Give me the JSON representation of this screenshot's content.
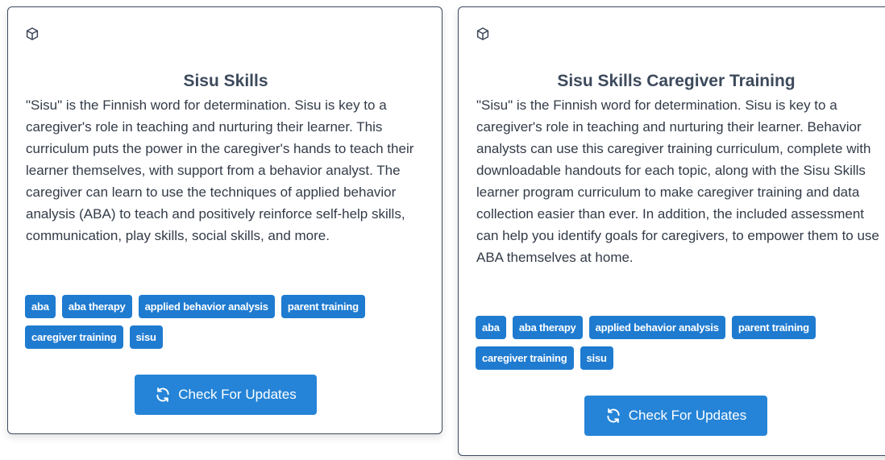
{
  "cards": [
    {
      "icon": "cube-icon",
      "title": "Sisu Skills",
      "description": "\"Sisu\" is the Finnish word for determination. Sisu is key to a caregiver's role in teaching and nurturing their learner. This curriculum puts the power in the caregiver's hands to teach their learner themselves, with support from a behavior analyst. The caregiver can learn to use the techniques of applied behavior analysis (ABA) to teach and positively reinforce self-help skills, communication, play skills, social skills, and more.",
      "tags": [
        "aba",
        "aba therapy",
        "applied behavior analysis",
        "parent training",
        "caregiver training",
        "sisu"
      ],
      "button_label": "Check For Updates",
      "button_icon": "refresh-icon"
    },
    {
      "icon": "cube-icon",
      "title": "Sisu Skills Caregiver Training",
      "description": "\"Sisu\" is the Finnish word for determination. Sisu is key to a caregiver's role in teaching and nurturing their learner. Behavior analysts can use this caregiver training curriculum, complete with downloadable handouts for each topic, along with the Sisu Skills learner program curriculum to make caregiver training and data collection easier than ever. In addition, the included assessment can help you identify goals for caregivers, to empower them to use ABA themselves at home.",
      "tags": [
        "aba",
        "aba therapy",
        "applied behavior analysis",
        "parent training",
        "caregiver training",
        "sisu"
      ],
      "button_label": "Check For Updates",
      "button_icon": "refresh-icon"
    }
  ],
  "colors": {
    "accent": "#2584d7",
    "tag_bg": "#1f7bd0",
    "title": "#3d4a5c",
    "border": "#3c4a5e"
  }
}
